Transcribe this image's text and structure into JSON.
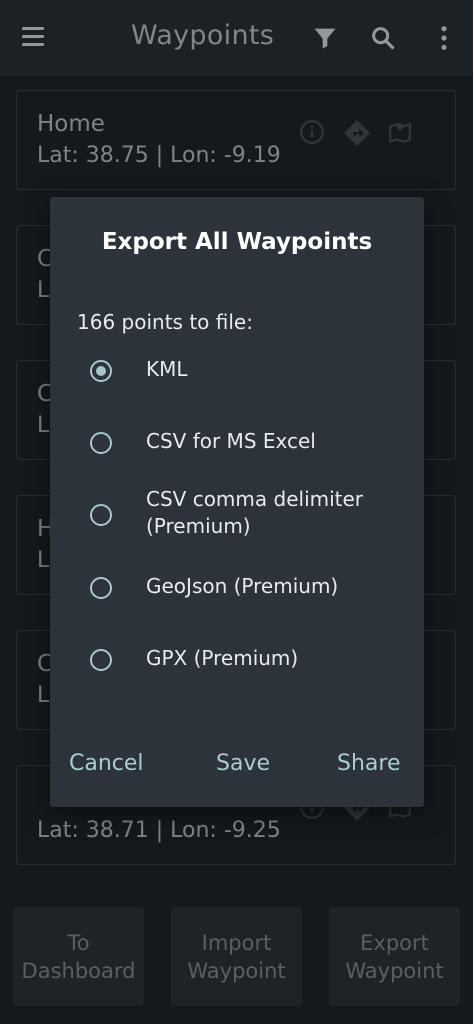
{
  "app_bar": {
    "title": "Waypoints",
    "icons": [
      "menu-icon",
      "filter-icon",
      "search-icon",
      "more-vert-icon"
    ]
  },
  "waypoints": [
    {
      "name": "Home",
      "coords": "Lat: 38.75 | Lon: -9.19"
    },
    {
      "name": "C",
      "coords": "L"
    },
    {
      "name": "C",
      "coords": "L"
    },
    {
      "name": "H",
      "coords": "L"
    },
    {
      "name": "C",
      "coords": "L"
    },
    {
      "name": "",
      "coords": "Lat: 38.71 | Lon: -9.25"
    }
  ],
  "bottom_buttons": {
    "dashboard": "To\nDashboard",
    "import": "Import\nWaypoint",
    "export": "Export\nWaypoint"
  },
  "dialog": {
    "title": "Export All Waypoints",
    "subtitle": "166 points to file:",
    "options": [
      {
        "label": "KML",
        "checked": true
      },
      {
        "label": "CSV for MS Excel",
        "checked": false
      },
      {
        "label": "CSV comma delimiter\n(Premium)",
        "checked": false
      },
      {
        "label": "GeoJson (Premium)",
        "checked": false
      },
      {
        "label": "GPX (Premium)",
        "checked": false
      }
    ],
    "buttons": {
      "cancel": "Cancel",
      "save": "Save",
      "share": "Share"
    }
  },
  "colors": {
    "background": "#23282d",
    "dialog": "#2d333a",
    "accent": "#a9cdcf"
  }
}
